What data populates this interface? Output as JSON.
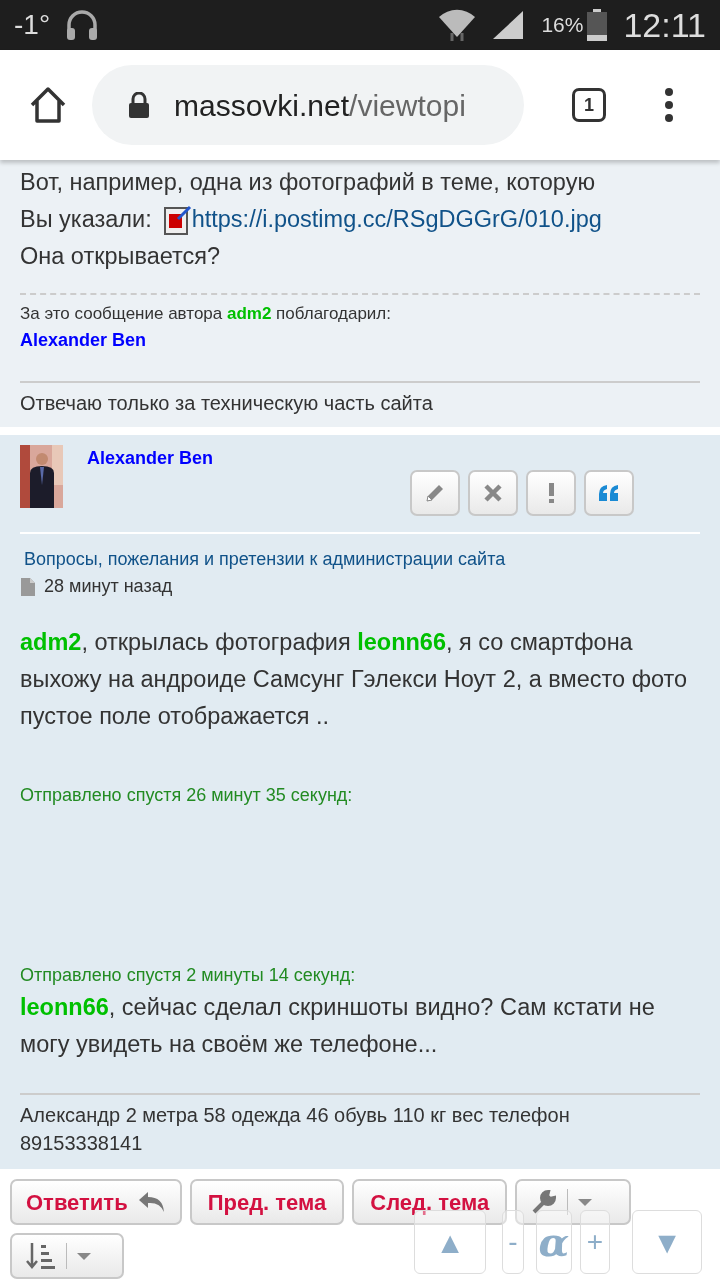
{
  "status_bar": {
    "temperature": "-1°",
    "battery": "16%",
    "time": "12:11"
  },
  "browser": {
    "url_host": "massovki.net",
    "url_path": "/viewtopi",
    "tab_count": "1"
  },
  "posts": [
    {
      "body": [
        {
          "kind": "text",
          "text": "Вот, например, одна из фотографий в теме, которую"
        },
        {
          "kind": "link_line",
          "text": "Вы указали:",
          "link": "https://i.postimg.cc/RSgDGGrG/010.jpg"
        },
        {
          "kind": "text",
          "text": "Она открывается?"
        }
      ],
      "thanks": {
        "before": "За это сообщение автора ",
        "author": "adm2",
        "after": " поблагодарил:",
        "users": [
          "Alexander Ben"
        ]
      },
      "signature": [
        "Отвечаю только за техническую часть сайта"
      ]
    },
    {
      "author": "Alexander Ben",
      "actions": [
        {
          "kind": "edit"
        },
        {
          "kind": "delete"
        },
        {
          "kind": "report"
        },
        {
          "kind": "quote"
        }
      ],
      "forum": "Вопросы, пожелания и претензии к администрации сайта",
      "time": "28 минут назад",
      "body": [
        {
          "kind": "paragraph",
          "parts": [
            {
              "mention": true,
              "text": "adm2"
            },
            {
              "mention": false,
              "text": ", открылась фотография "
            },
            {
              "mention": true,
              "text": "leonn66"
            },
            {
              "mention": false,
              "text": ", я со смартфона выхожу на андроиде Самсунг Гэлекси Ноут 2, а вместо фото пустое поле отображается .."
            }
          ]
        },
        {
          "kind": "note",
          "text": "Отправлено спустя 26 минут 35 секунд:"
        },
        {
          "kind": "gap"
        },
        {
          "kind": "note",
          "text": "Отправлено спустя 2 минуты 14 секунд:"
        },
        {
          "kind": "paragraph",
          "parts": [
            {
              "mention": true,
              "text": "leonn66"
            },
            {
              "mention": false,
              "text": ", сейчас сделал скриншоты видно? Сам кстати не могу увидеть на своём же телефоне..."
            }
          ]
        }
      ],
      "signature": [
        "Александр 2 метра 58 одежда 46 обувь 110 кг вес телефон 89153338141"
      ]
    }
  ],
  "toolbar": [
    {
      "kind": "text_icon",
      "label": "Ответить"
    },
    {
      "kind": "text",
      "label": "Пред. тема"
    },
    {
      "kind": "text",
      "label": "След. тема"
    },
    {
      "kind": "tools"
    },
    {
      "kind": "sort"
    }
  ],
  "float_nav": [
    "▲",
    "-",
    "α",
    "+",
    "▼"
  ]
}
